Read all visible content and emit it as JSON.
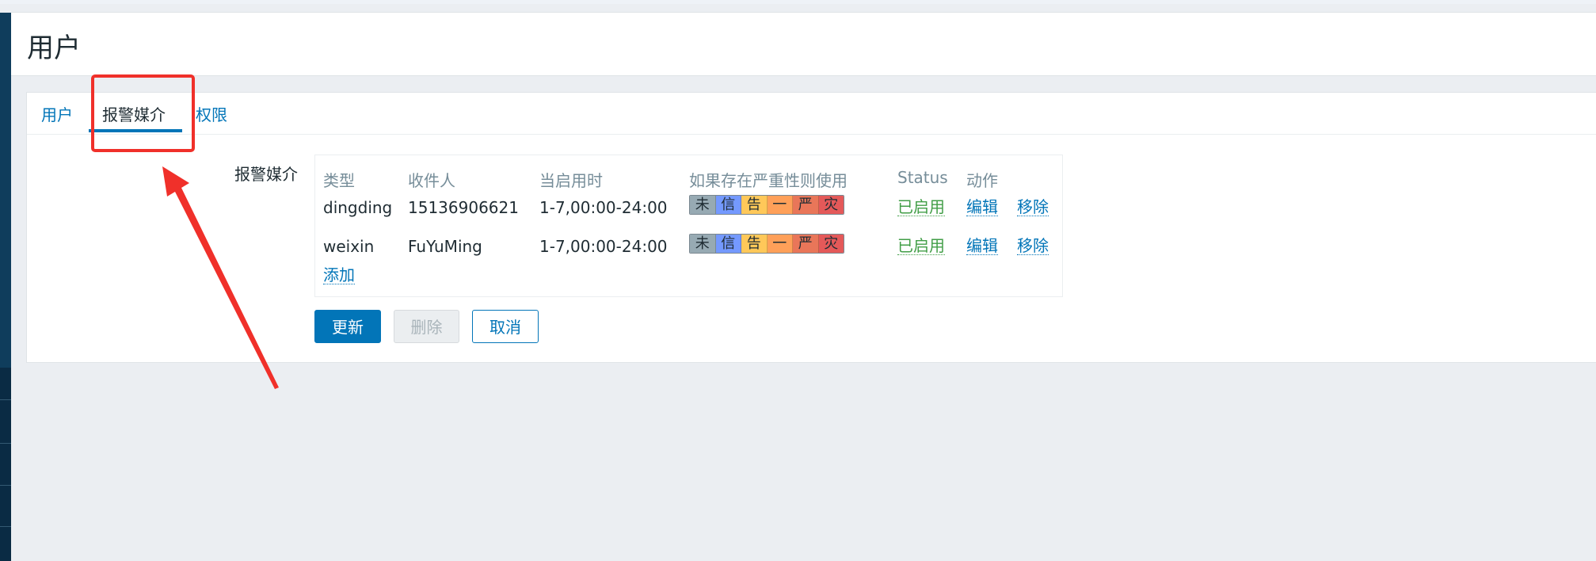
{
  "page": {
    "title": "用户"
  },
  "tabs": [
    {
      "label": "用户",
      "active": false
    },
    {
      "label": "报警媒介",
      "active": true
    },
    {
      "label": "权限",
      "active": false
    }
  ],
  "form": {
    "media_label": "报警媒介"
  },
  "media_table": {
    "headers": {
      "type": "类型",
      "sendto": "收件人",
      "when_active": "当启用时",
      "severity": "如果存在严重性则使用",
      "status": "Status",
      "action": "动作"
    },
    "rows": [
      {
        "type": "dingding",
        "sendto": "15136906621",
        "when_active": "1-7,00:00-24:00",
        "status": "已启用",
        "edit": "编辑",
        "remove": "移除"
      },
      {
        "type": "weixin",
        "sendto": "FuYuMing",
        "when_active": "1-7,00:00-24:00",
        "status": "已启用",
        "edit": "编辑",
        "remove": "移除"
      }
    ],
    "add_link": "添加"
  },
  "severity_levels": [
    {
      "label": "未",
      "color": "#97aab3"
    },
    {
      "label": "信",
      "color": "#7499ff"
    },
    {
      "label": "告",
      "color": "#ffc859"
    },
    {
      "label": "一",
      "color": "#ffa059"
    },
    {
      "label": "严",
      "color": "#e97659"
    },
    {
      "label": "灾",
      "color": "#e45959"
    }
  ],
  "buttons": {
    "update": "更新",
    "delete": "删除",
    "cancel": "取消"
  },
  "annotation_color": "#f0302a"
}
